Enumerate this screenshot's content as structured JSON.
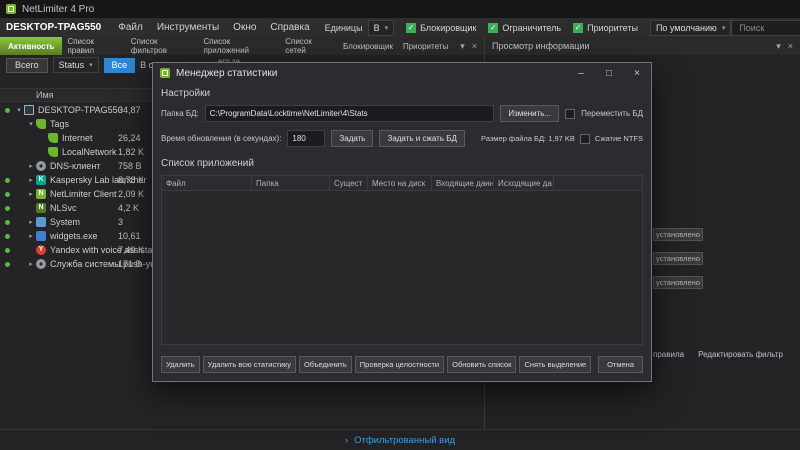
{
  "app": {
    "title": "NetLimiter 4 Pro"
  },
  "icons": {
    "check": "✓",
    "caret": "▾",
    "close": "×",
    "collapsed": "▸",
    "expanded": "▾",
    "chevron_right": "›"
  },
  "icon_letters": {
    "kaspersky": "K",
    "yandex": "Y",
    "netlimiter": "N",
    "netlimiter2": "N"
  },
  "colors": {
    "accent_green": "#76b82a",
    "accent_blue": "#2f86d4"
  },
  "menubar": {
    "host": "DESKTOP-TPAG550",
    "menus": [
      "Файл",
      "Инструменты",
      "Окно",
      "Справка"
    ],
    "units_label": "Единицы",
    "units_value": "B",
    "toggles": [
      {
        "label": "Блокировщик",
        "checked": true
      },
      {
        "label": "Ограничитель",
        "checked": true
      },
      {
        "label": "Приоритеты",
        "checked": true
      }
    ],
    "preset_value": "По умолчанию",
    "search_placeholder": "Поиск"
  },
  "tabbar": {
    "tabs": [
      {
        "label": "Активность",
        "active": true
      },
      {
        "label": "Список правил",
        "active": false
      },
      {
        "label": "Список фильтров",
        "active": false
      },
      {
        "label": "Список приложений",
        "active": false
      },
      {
        "label": "Список сетей",
        "active": false
      },
      {
        "label": "Блокировщик",
        "active": false
      },
      {
        "label": "Приоритеты",
        "active": false
      }
    ],
    "panel_title": "Просмотр информации"
  },
  "left_panel": {
    "total_button": "Всего",
    "status_dropdown": "Status",
    "all_button": "Все",
    "online_label": "В сети",
    "fragment": "его за",
    "name_column": "Имя",
    "rows": [
      {
        "label": "DESKTOP-TPAG550",
        "value": "34,87",
        "icon": "computer",
        "level": 0,
        "dot": true,
        "arrow": true,
        "expanded": true
      },
      {
        "label": "Tags",
        "value": "",
        "icon": "tag",
        "level": 1,
        "dot": false,
        "arrow": true,
        "expanded": true
      },
      {
        "label": "Internet",
        "value": "26,24",
        "icon": "tag",
        "level": 2,
        "dot": false,
        "arrow": false,
        "expanded": false
      },
      {
        "label": "LocalNetwork",
        "value": "1,82 K",
        "icon": "tag",
        "level": 2,
        "dot": false,
        "arrow": false,
        "expanded": false
      },
      {
        "label": "DNS-клиент",
        "value": "758 B",
        "icon": "gear",
        "level": 1,
        "dot": false,
        "arrow": true,
        "expanded": false
      },
      {
        "label": "Kaspersky Lab launcher",
        "value": "8,78 K",
        "icon": "kaspersky",
        "level": 1,
        "dot": true,
        "arrow": true,
        "expanded": false
      },
      {
        "label": "NetLimiter Client",
        "value": "2,09 K",
        "icon": "netlimiter",
        "level": 1,
        "dot": true,
        "arrow": true,
        "expanded": false
      },
      {
        "label": "NLSvc",
        "value": "4,2 K",
        "icon": "netlimiter2",
        "level": 1,
        "dot": true,
        "arrow": false,
        "expanded": false
      },
      {
        "label": "System",
        "value": "3",
        "icon": "system",
        "level": 1,
        "dot": true,
        "arrow": true,
        "expanded": false
      },
      {
        "label": "widgets.exe",
        "value": "10,61",
        "icon": "widgets",
        "level": 1,
        "dot": true,
        "arrow": true,
        "expanded": false
      },
      {
        "label": "Yandex with voice assistant",
        "value": "7,49 K",
        "icon": "yandex",
        "level": 1,
        "dot": true,
        "arrow": false,
        "expanded": false
      },
      {
        "label": "Служба системы push-уве",
        "value": "171 B",
        "icon": "gear",
        "level": 1,
        "dot": true,
        "arrow": true,
        "expanded": false
      }
    ]
  },
  "info_panel": {
    "badges": [
      "установлено",
      "установлено",
      "установлено"
    ],
    "links": [
      "правила",
      "Редактировать фильтр"
    ]
  },
  "footer": {
    "filtered_view": "Отфильтрованный вид"
  },
  "dialog": {
    "title": "Менеджер статистики",
    "window_controls": {
      "minimize": "–",
      "maximize": "□",
      "close": "×"
    },
    "settings_section": "Настройки",
    "db_folder": {
      "label": "Папка БД:",
      "value": "C:\\ProgramData\\Locktime\\NetLimiter\\4\\Stats",
      "change_button": "Изменить...",
      "move_checkbox": "Переместить БД"
    },
    "refresh": {
      "label": "Время обновления (в секундах):",
      "value": "180",
      "set_button": "Задать",
      "set_compact_button": "Задать и сжать БД",
      "db_size": "Размер файла БД: 1,97 KB",
      "ntfs_checkbox": "Сжатие NTFS"
    },
    "apps_section": "Список приложений",
    "table_headers": [
      "Файл",
      "Папка",
      "Сущест",
      "Место на диск",
      "Входящие данн",
      "Исходящие да"
    ],
    "footer_buttons": [
      "Удалить",
      "Удалить всю статистику",
      "Объединить",
      "Проверка целостности",
      "Обновить список",
      "Снять выделение"
    ],
    "cancel_button": "Отмена"
  }
}
